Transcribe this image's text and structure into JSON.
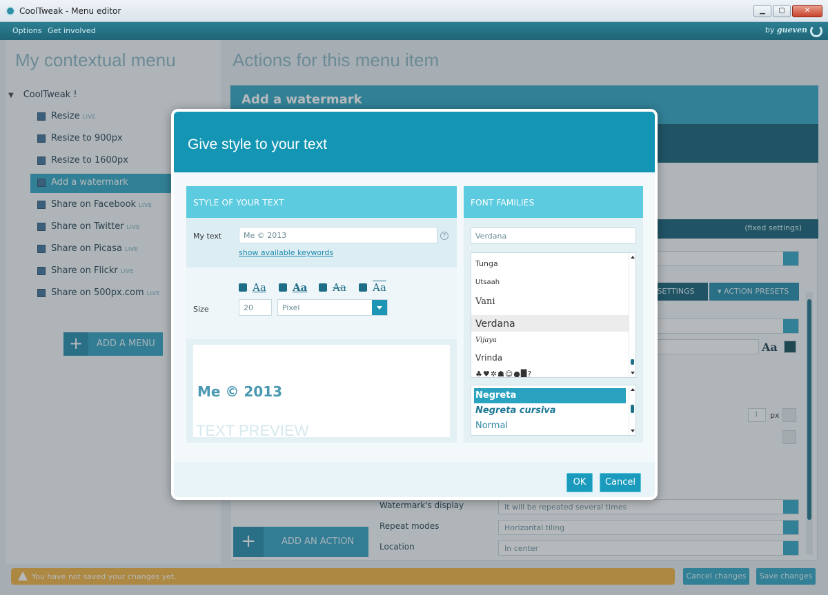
{
  "window": {
    "title": "CoolTweak - Menu editor",
    "minimize": "▁",
    "maximize": "▢",
    "close": "✕"
  },
  "menubar": {
    "items": [
      "Options",
      "Get involved"
    ],
    "brand_prefix": "by",
    "brand_name": "gueven"
  },
  "left": {
    "title": "My contextual menu",
    "root": "CoolTweak !",
    "items": [
      {
        "label": "Resize",
        "tag": "LIVE"
      },
      {
        "label": "Resize to 900px",
        "tag": ""
      },
      {
        "label": "Resize to 1600px",
        "tag": ""
      },
      {
        "label": "Add a watermark",
        "tag": ""
      },
      {
        "label": "Share on Facebook",
        "tag": "LIVE"
      },
      {
        "label": "Share on Twitter",
        "tag": "LIVE"
      },
      {
        "label": "Share on Picasa",
        "tag": "LIVE"
      },
      {
        "label": "Share on Flickr",
        "tag": "LIVE"
      },
      {
        "label": "Share on 500px.com",
        "tag": "LIVE"
      }
    ],
    "add_menu": "ADD A MENU"
  },
  "right": {
    "title": "Actions for this menu item",
    "action_name": "Add a watermark",
    "fixed_settings": "(fixed settings)",
    "base_settings": "E SETTINGS",
    "action_presets": "ACTION PRESETS",
    "px_value": "1",
    "px_unit": "px",
    "aa": "Aa",
    "fields": [
      {
        "label": "Watermark's display",
        "value": "It will be repeated several times"
      },
      {
        "label": "Repeat modes",
        "value": "Horizontal tiling"
      },
      {
        "label": "Location",
        "value": "In center"
      }
    ],
    "add_action": "ADD AN ACTION"
  },
  "status": {
    "warning": "You have not saved your changes yet.",
    "cancel": "Cancel changes",
    "save": "Save changes"
  },
  "modal": {
    "title": "Give style to your text",
    "style_header": "STYLE OF YOUR TEXT",
    "my_text_label": "My text",
    "my_text_value": "Me © 2013",
    "help": "?",
    "keywords_link": "show available keywords",
    "style_sample": "Aa",
    "size_label": "Size",
    "size_value": "20",
    "size_unit": "Pixel",
    "preview_text": "Me © 2013",
    "preview_label": "TEXT PREVIEW",
    "fonts_header": "FONT FAMILIES",
    "font_value": "Verdana",
    "font_list": [
      "Tunga",
      "Utsaah",
      "Vani",
      "Verdana",
      "Vijaya",
      "Vrinda",
      "♣♥✲☗☺●█?"
    ],
    "weights": [
      "Negreta",
      "Negreta cursiva",
      "Normal"
    ],
    "ok": "OK",
    "cancel": "Cancel"
  },
  "colors": {
    "accent": "#1495b4",
    "header_light": "#5ccbdf",
    "dark": "#0f5d73",
    "warning": "#f2b13a"
  }
}
